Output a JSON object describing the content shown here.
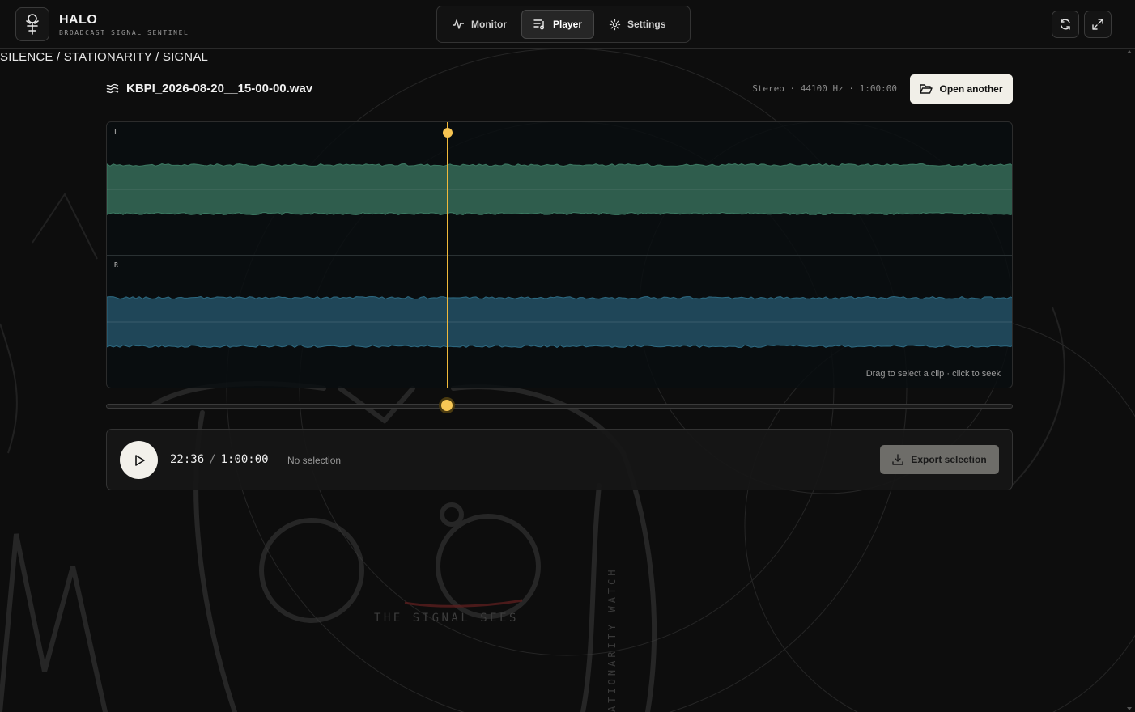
{
  "app": {
    "name": "HALO",
    "subtitle": "BROADCAST SIGNAL SENTINEL"
  },
  "nav": {
    "tabs": [
      {
        "label": "Monitor",
        "icon": "activity-icon",
        "active": false
      },
      {
        "label": "Player",
        "icon": "playlist-icon",
        "active": true
      },
      {
        "label": "Settings",
        "icon": "gear-icon",
        "active": false
      }
    ]
  },
  "header_actions": [
    {
      "name": "refresh-button",
      "icon": "refresh-icon"
    },
    {
      "name": "fullscreen-button",
      "icon": "expand-icon"
    }
  ],
  "breadcrumb": "SILENCE / STATIONARITY / SIGNAL",
  "file": {
    "name": "KBPI_2026-08-20__15-00-00.wav",
    "meta": "Stereo · 44100 Hz · 1:00:00",
    "open_label": "Open another"
  },
  "waveform": {
    "channels": [
      {
        "label": "L",
        "color": "#2f5d4d",
        "edge": "#3d7a63"
      },
      {
        "label": "R",
        "color": "#1f4658",
        "edge": "#2d6a82"
      }
    ],
    "hint": "Drag to select a clip · click to seek",
    "playhead_fraction": 0.376
  },
  "transport": {
    "current_time": "22:36",
    "separator": "/",
    "duration": "1:00:00",
    "selection_status": "No selection",
    "export_label": "Export selection"
  },
  "background_art": {
    "caption": "THE SIGNAL SEES",
    "side_text": "ATIONARITY WATCH"
  },
  "colors": {
    "accent": "#f6c452",
    "background": "#0d0d0d"
  }
}
